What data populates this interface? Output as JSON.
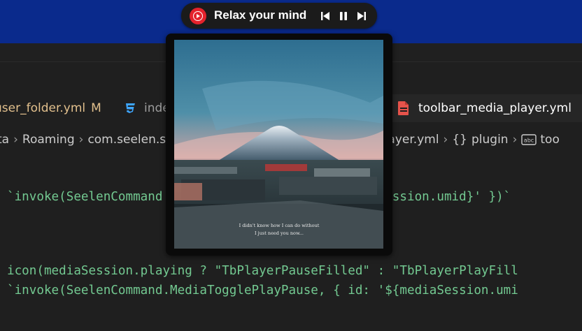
{
  "media_widget": {
    "title": "Relax your mind",
    "app_icon": "youtube-music-icon",
    "controls": [
      {
        "name": "previous-icon"
      },
      {
        "name": "pause-icon"
      },
      {
        "name": "next-icon"
      }
    ]
  },
  "album_art": {
    "caption_line1": "I didn't know how I can do without",
    "caption_line2": "I just need you now..."
  },
  "editor": {
    "tabs": [
      {
        "label": "user_folder.yml",
        "badge": "M",
        "icon": "yml-icon"
      },
      {
        "label": "inde",
        "icon": "css-icon"
      },
      {
        "label": "toolbar_media_player.yml",
        "icon": "file-icon"
      }
    ],
    "breadcrumb": {
      "left": [
        "ta",
        "Roaming",
        "com.seelen.s"
      ],
      "right": {
        "file": "a_player.yml",
        "brace": "{}",
        "plugin": "plugin",
        "last": "too"
      }
    },
    "code_lines": [
      "`invoke(SeelenCommand                           iaSession.umid}' })`",
      "icon(mediaSession.playing ? \"TbPlayerPauseFilled\" : \"TbPlayerPlayFill",
      "`invoke(SeelenCommand.MediaTogglePlayPause, { id: '${mediaSession.umi"
    ]
  },
  "colors": {
    "desktop": "#0a2a8c",
    "editor_bg": "#1f1f1f",
    "code": "#73c991",
    "modified": "#e2c08d",
    "accent_red": "#e4222c"
  }
}
